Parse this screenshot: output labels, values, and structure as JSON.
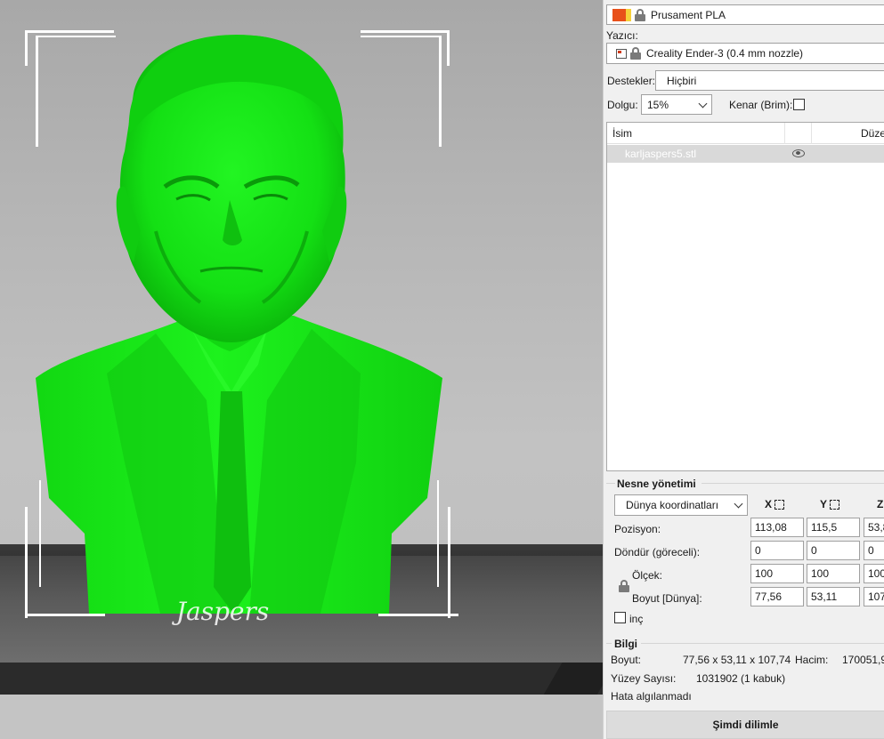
{
  "filament": {
    "name": "Prusament PLA",
    "swatch_colors": [
      "#e8501a",
      "#f5d03a"
    ]
  },
  "printer": {
    "label": "Yazıcı:",
    "name": "Creality Ender-3 (0.4 mm nozzle)"
  },
  "supports": {
    "label": "Destekler:",
    "value": "Hiçbiri"
  },
  "infill": {
    "label": "Dolgu:",
    "value": "15%"
  },
  "brim": {
    "label": "Kenar (Brim):",
    "checked": false
  },
  "object_list": {
    "columns": [
      "İsim",
      "",
      "Düze"
    ],
    "items": [
      {
        "name": "karljaspers5.stl",
        "visible_icon": "eye-icon"
      }
    ]
  },
  "object_manipulation": {
    "title": "Nesne yönetimi",
    "coord_system": "Dünya koordinatları",
    "axes": [
      "X",
      "Y",
      "Z"
    ],
    "rows": [
      {
        "label": "Pozisyon:",
        "values": [
          "113,08",
          "115,5",
          "53,8"
        ]
      },
      {
        "label": "Döndür (göreceli):",
        "values": [
          "0",
          "0",
          "0"
        ]
      },
      {
        "label": "Ölçek:",
        "values": [
          "100",
          "100",
          "100"
        ]
      },
      {
        "label": "Boyut [Dünya]:",
        "values": [
          "77,56",
          "53,11",
          "107,"
        ]
      }
    ],
    "inch_label": "inç"
  },
  "info": {
    "title": "Bilgi",
    "size_label": "Boyut:",
    "size_value": "77,56 x 53,11 x 107,74",
    "volume_label": "Hacim:",
    "volume_value": "170051,9",
    "facets_label": "Yüzey Sayısı:",
    "facets_value": "1031902 (1 kabuk)",
    "errors": "Hata algılanmadı"
  },
  "slice_button": "Şimdi dilimle",
  "colors": {
    "model": "#11ee11",
    "model_shadow": "#0a9a0a",
    "bed": "#3a3a3a"
  }
}
